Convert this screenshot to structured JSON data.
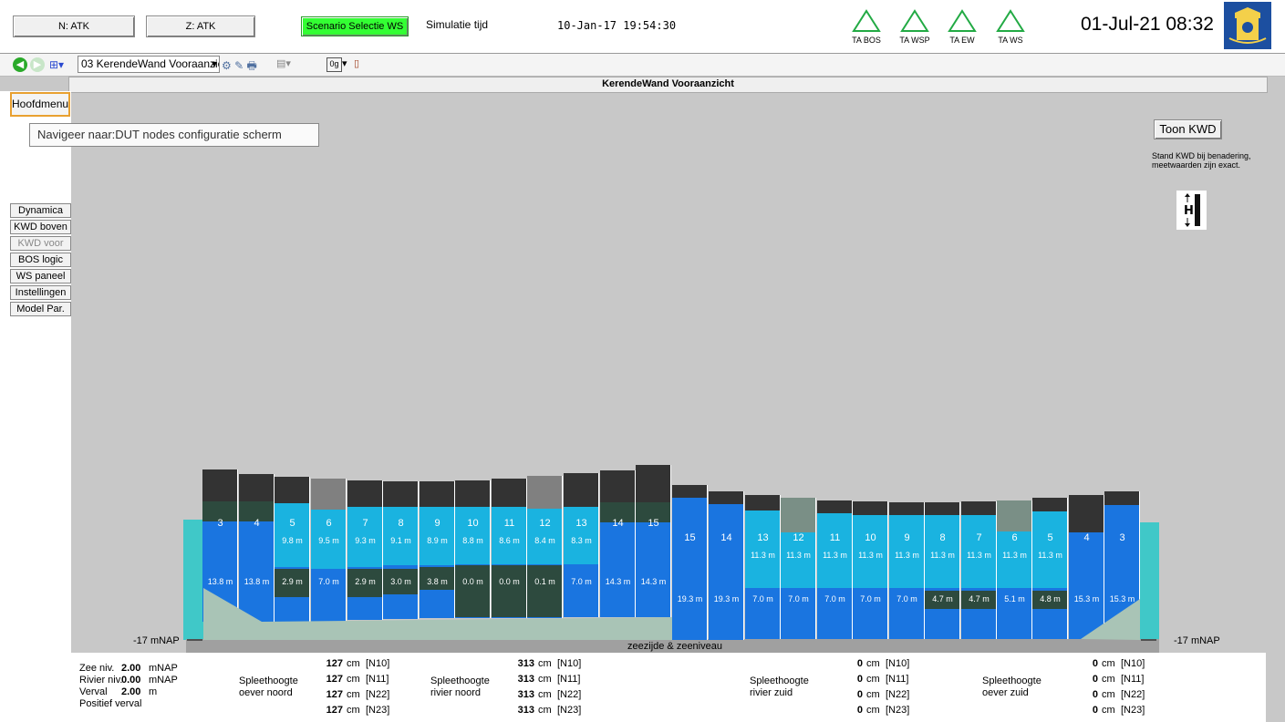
{
  "topbar": {
    "n_button": "N: ATK",
    "z_button": "Z: ATK",
    "scenario_button": "Scenario Selectie WS",
    "sim_label": "Simulatie tijd",
    "sim_time": "10-Jan-17 19:54:30",
    "alarms": [
      "TA BOS",
      "TA WSP",
      "TA EW",
      "TA WS"
    ],
    "clock": "01-Jul-21 08:32"
  },
  "toolbar": {
    "dropdown_value": "03 KerendeWand Vooraanzic",
    "zoom_badge": "0g"
  },
  "title": "KerendeWand Vooraanzicht",
  "menu": {
    "hoofdmenu": "Hoofdmenu",
    "tooltip": "Navigeer naar:DUT nodes configuratie scherm",
    "items": [
      "Dynamica",
      "KWD boven",
      "KWD voor",
      "BOS logic",
      "WS paneel",
      "Instellingen",
      "Model Par."
    ]
  },
  "right": {
    "toon_kwd": "Toon KWD",
    "note": "Stand KWD bij benadering, meetwaarden zijn exact."
  },
  "diagram": {
    "left_scale": "-17 mNAP",
    "right_scale": "-17 mNAP",
    "bottom_label": "zeezijde & zeeniveau",
    "colors": {
      "dark": "#333333",
      "darkgreen": "#2d4a3e",
      "light": "#1ab3e0",
      "blue": "#1a75e0",
      "grey": "#808080",
      "ground": "#a9c4b6",
      "edge": "#40c8c8"
    },
    "north": {
      "numbers": [
        "3",
        "4",
        "5",
        "6",
        "7",
        "8",
        "9",
        "10",
        "11",
        "12",
        "13",
        "14",
        "15"
      ],
      "upper": [
        "",
        "",
        "9.8 m",
        "9.5 m",
        "9.3 m",
        "9.1 m",
        "8.9 m",
        "8.8 m",
        "8.6 m",
        "8.4 m",
        "8.3 m",
        "",
        ""
      ],
      "lower": [
        "13.8 m",
        "13.8 m",
        "2.9 m",
        "7.0 m",
        "2.9 m",
        "3.0 m",
        "3.8 m",
        "0.0 m",
        "0.0 m",
        "0.1 m",
        "7.0 m",
        "14.3 m",
        "14.3 m"
      ]
    },
    "south": {
      "numbers": [
        "15",
        "14",
        "13",
        "12",
        "11",
        "10",
        "9",
        "8",
        "7",
        "6",
        "5",
        "4",
        "3"
      ],
      "upper": [
        "",
        "",
        "11.3 m",
        "11.3 m",
        "11.3 m",
        "11.3 m",
        "11.3 m",
        "11.3 m",
        "11.3 m",
        "11.3 m",
        "11.3 m",
        "",
        ""
      ],
      "lower": [
        "19.3 m",
        "19.3 m",
        "7.0 m",
        "7.0 m",
        "7.0 m",
        "7.0 m",
        "7.0 m",
        "4.7 m",
        "4.7 m",
        "5.1 m",
        "4.8 m",
        "15.3 m",
        "15.3 m"
      ]
    }
  },
  "levels": {
    "zee_label": "Zee niv.",
    "zee_value": "2.00",
    "zee_unit": "mNAP",
    "rivier_label": "Rivier niv.",
    "rivier_value": "0.00",
    "rivier_unit": "mNAP",
    "verval_label": "Verval",
    "verval_value": "2.00",
    "verval_unit": "m",
    "positief": "Positief verval"
  },
  "gaps": [
    {
      "title1": "Spleethoogte",
      "title2": "oever noord",
      "rows": [
        {
          "v": "127",
          "n": "[N10]"
        },
        {
          "v": "127",
          "n": "[N11]"
        },
        {
          "v": "127",
          "n": "[N22]"
        },
        {
          "v": "127",
          "n": "[N23]"
        }
      ]
    },
    {
      "title1": "Spleethoogte",
      "title2": "rivier noord",
      "rows": [
        {
          "v": "313",
          "n": "[N10]"
        },
        {
          "v": "313",
          "n": "[N11]"
        },
        {
          "v": "313",
          "n": "[N22]"
        },
        {
          "v": "313",
          "n": "[N23]"
        }
      ]
    },
    {
      "title1": "Spleethoogte",
      "title2": "rivier zuid",
      "rows": [
        {
          "v": "0",
          "n": "[N10]"
        },
        {
          "v": "0",
          "n": "[N11]"
        },
        {
          "v": "0",
          "n": "[N22]"
        },
        {
          "v": "0",
          "n": "[N23]"
        }
      ]
    },
    {
      "title1": "Spleethoogte",
      "title2": "oever zuid",
      "rows": [
        {
          "v": "0",
          "n": "[N10]"
        },
        {
          "v": "0",
          "n": "[N11]"
        },
        {
          "v": "0",
          "n": "[N22]"
        },
        {
          "v": "0",
          "n": "[N23]"
        }
      ]
    }
  ],
  "unit_cm": "cm"
}
